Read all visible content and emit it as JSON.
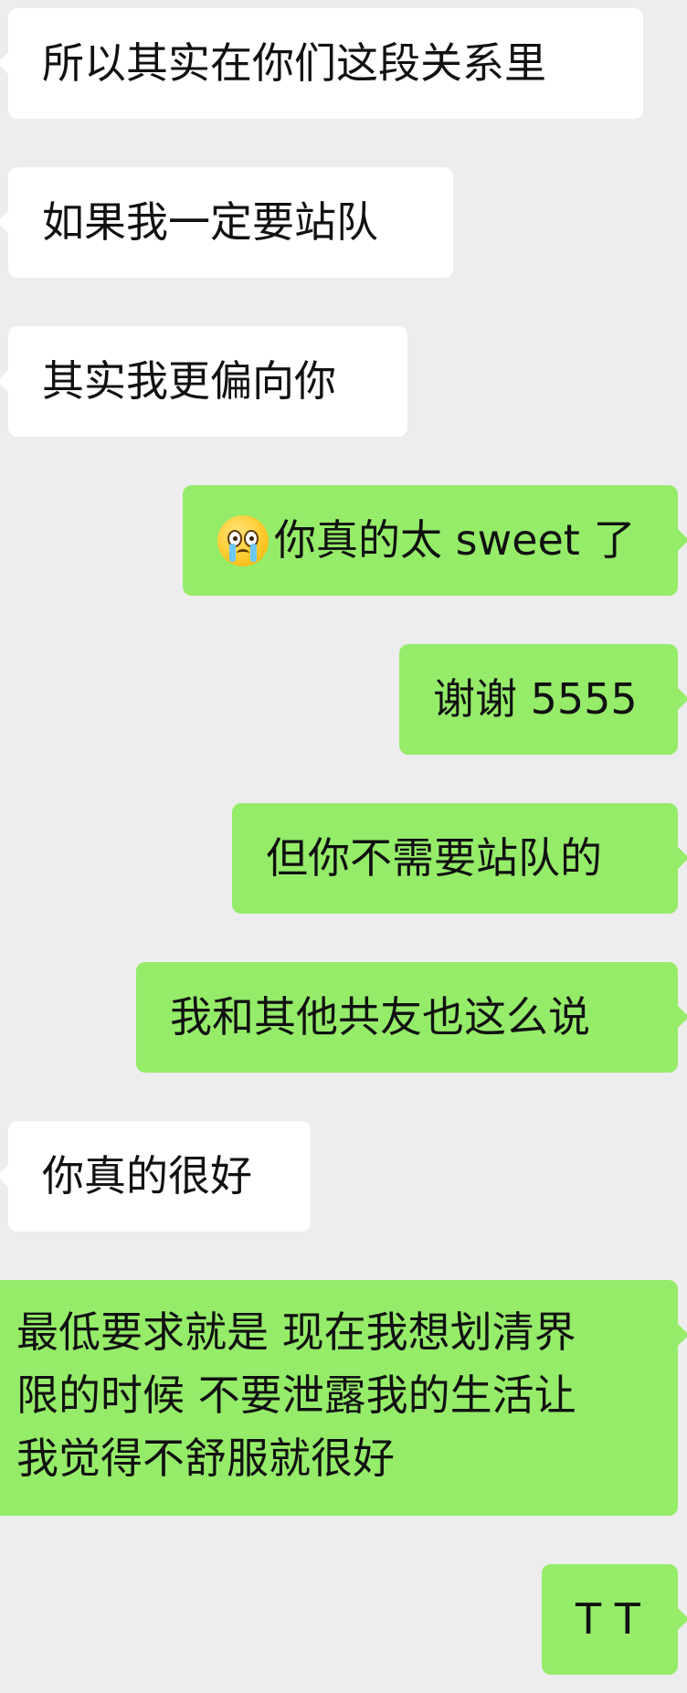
{
  "messages": [
    {
      "side": "incoming",
      "text": "所以其实在你们这段关系里"
    },
    {
      "side": "incoming",
      "text": "如果我一定要站队"
    },
    {
      "side": "incoming",
      "text": "其实我更偏向你"
    },
    {
      "side": "outgoing",
      "emoji": "crying-face-icon",
      "text": "你真的太 sweet 了"
    },
    {
      "side": "outgoing",
      "text": "谢谢 5555"
    },
    {
      "side": "outgoing",
      "text": "但你不需要站队的"
    },
    {
      "side": "outgoing",
      "text": "我和其他共友也这么说"
    },
    {
      "side": "incoming",
      "text": "你真的很好"
    },
    {
      "side": "outgoing",
      "lines": [
        "最低要求就是 现在我想划清界",
        "限的时候 不要泄露我的生活让",
        "我觉得不舒服就很好"
      ]
    },
    {
      "side": "outgoing",
      "text": "T T"
    }
  ],
  "colors": {
    "background": "#ededed",
    "incoming_bubble": "#ffffff",
    "outgoing_bubble": "#95ec69",
    "text": "#111111"
  }
}
